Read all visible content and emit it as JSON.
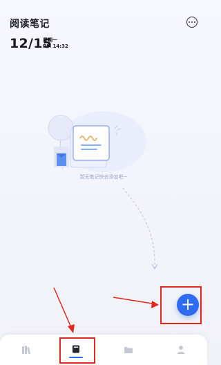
{
  "header": {
    "app_title": "阅读笔记",
    "date": "12/15",
    "weekday": "星期一",
    "time": "PM 14:32"
  },
  "empty_state": {
    "hint": "暂无笔记快去添加吧~"
  },
  "colors": {
    "accent": "#2f6bef",
    "annotation_red": "#e3271e",
    "hint_text": "#9aa3c7"
  },
  "tabbar": {
    "tabs": [
      {
        "icon": "books-icon",
        "active": false
      },
      {
        "icon": "note-icon",
        "active": true
      },
      {
        "icon": "folder-icon",
        "active": false
      },
      {
        "icon": "user-icon",
        "active": false
      }
    ]
  },
  "fab": {
    "icon": "plus-icon"
  }
}
